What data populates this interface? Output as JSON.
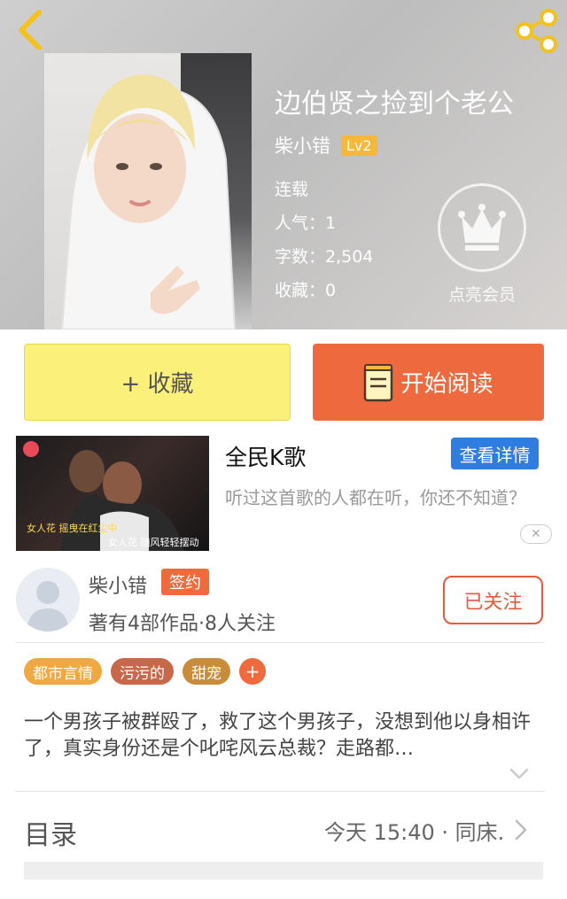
{
  "book": {
    "title": "边伯贤之捡到个老公",
    "author": "柴小错",
    "level": "Lv2",
    "status": "连载",
    "popularity": "人气：1",
    "word_count": "字数：2,504",
    "favorites": "收藏：0",
    "vip_label": "点亮会员"
  },
  "actions": {
    "collect_label": "+ 收藏",
    "read_label": "开始阅读"
  },
  "ad": {
    "title": "全民K歌",
    "detail_button": "查看详情",
    "description": "听过这首歌的人都在听，你还不知道？",
    "caption_line1": "女人花 摇曳在红尘中",
    "caption_line2": "女人花 随风轻轻摆动",
    "close_label": "✕"
  },
  "author_card": {
    "name": "柴小错",
    "badge": "签约",
    "meta": "著有4部作品·8人关注",
    "follow_label": "已关注"
  },
  "tags": [
    {
      "label": "都市言情",
      "color": "#f0a842"
    },
    {
      "label": "污污的",
      "color": "#c8684a"
    },
    {
      "label": "甜宠",
      "color": "#c98c3a"
    }
  ],
  "tag_add": "+",
  "synopsis": "一个男孩子被群殴了，救了这个男孩子，没想到他以身相许了，真实身份还是个叱咤风云总裁？走路都…",
  "toc": {
    "label": "目录",
    "latest": "今天 15:40 · 同床."
  },
  "colors": {
    "accent_orange": "#ee6a3e",
    "collect_yellow": "#fbf07a",
    "detail_blue": "#2f7de0",
    "level_gold": "#f5b83a"
  }
}
